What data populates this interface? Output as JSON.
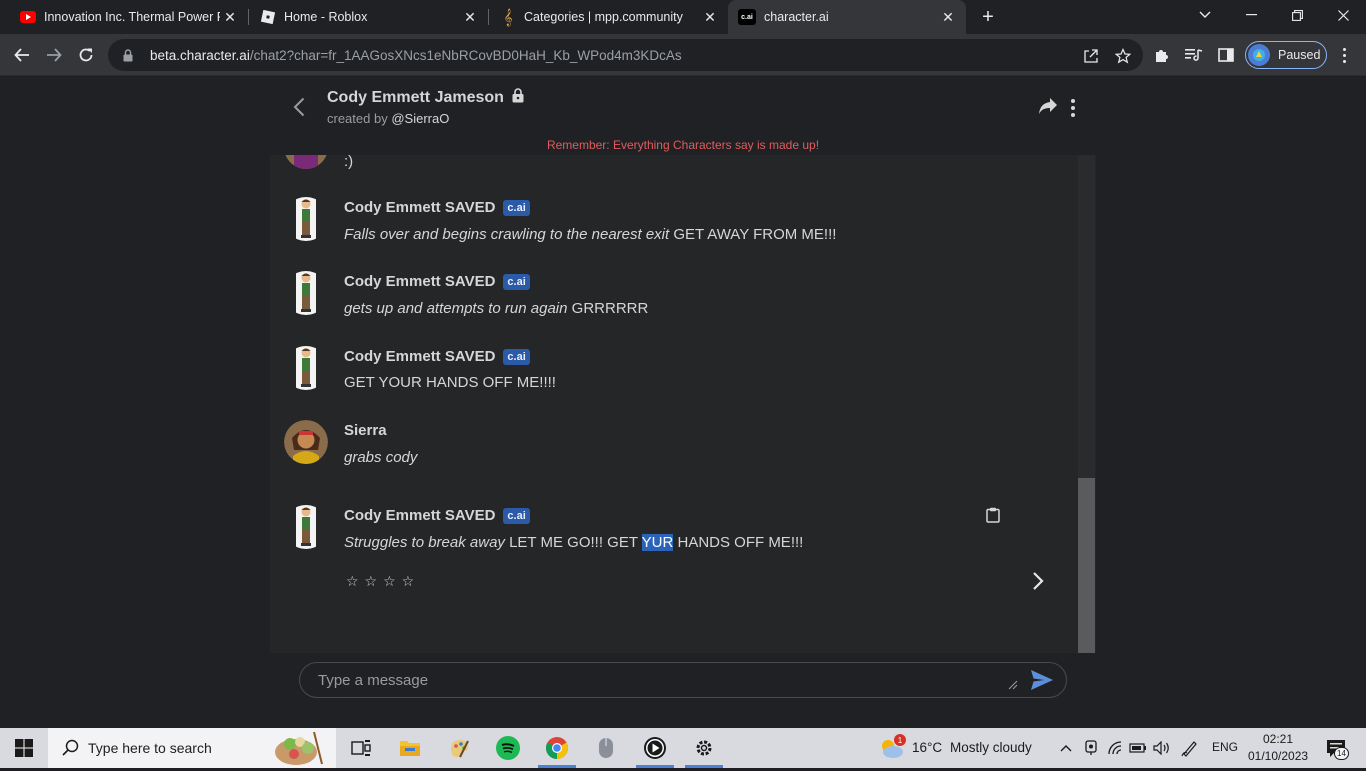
{
  "browser": {
    "tabs": [
      {
        "title": "Innovation Inc. Thermal Power P",
        "icon": "youtube-icon",
        "active": false
      },
      {
        "title": "Home - Roblox",
        "icon": "roblox-icon",
        "active": false
      },
      {
        "title": "Categories | mpp.community",
        "icon": "music-note-icon",
        "active": false
      },
      {
        "title": "character.ai",
        "icon": "cai-icon",
        "active": true
      }
    ],
    "cai_favicon_text": "c.ai",
    "url_host": "beta.character.ai",
    "url_path": "/chat2?char=fr_1AAGosXNcs1eNbRCovBD0HaH_Kb_WPod4m3KDcAs",
    "profile_label": "Paused"
  },
  "chat": {
    "character_name": "Cody Emmett Jameson",
    "created_by_prefix": "created by",
    "creator": "@SierraO",
    "warning": "Remember: Everything Characters say is made up!",
    "badge": "c.ai",
    "partial_message_text": ":)",
    "messages": [
      {
        "sender": "Cody Emmett SAVED",
        "action": "Falls over and begins crawling to the nearest exit",
        "speech": " GET AWAY FROM ME!!!"
      },
      {
        "sender": "Cody Emmett SAVED",
        "action": "gets up and attempts to run again",
        "speech": " GRRRRRR"
      },
      {
        "sender": "Cody Emmett SAVED",
        "action": "",
        "speech": "GET YOUR HANDS OFF ME!!!!"
      },
      {
        "sender": "Sierra",
        "action": "grabs cody",
        "speech": ""
      },
      {
        "sender": "Cody Emmett SAVED",
        "action": "Struggles to break away",
        "speech_before": " LET ME GO!!! GET ",
        "speech_highlight": "YUR",
        "speech_after": " HANDS OFF ME!!!"
      }
    ],
    "rating_stars": "☆☆☆☆",
    "composer_placeholder": "Type a message"
  },
  "taskbar": {
    "search_placeholder": "Type here to search",
    "weather_temp": "16°C",
    "weather_desc": "Mostly cloudy",
    "weather_alert_count": "1",
    "language": "ENG",
    "time": "02:21",
    "date": "01/10/2023",
    "notification_count": "14"
  },
  "colors": {
    "accent_blue": "#2a5aa8",
    "warning_red": "#e05c5c",
    "page_bg": "#202124"
  }
}
